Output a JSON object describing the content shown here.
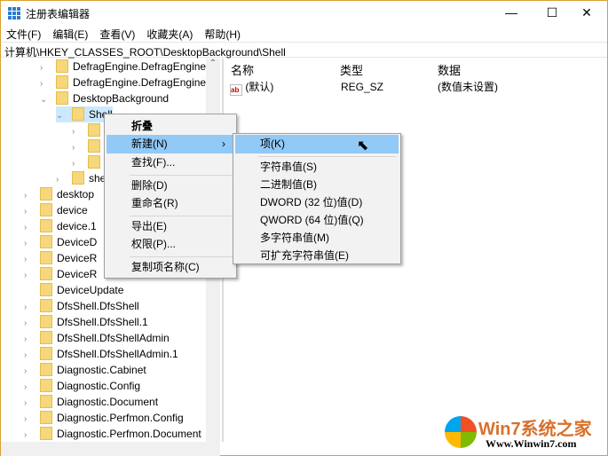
{
  "window": {
    "title": "注册表编辑器",
    "minimize": "—",
    "maximize": "☐",
    "close": "✕"
  },
  "menubar": [
    "文件(F)",
    "编辑(E)",
    "查看(V)",
    "收藏夹(A)",
    "帮助(H)"
  ],
  "address": "计算机\\HKEY_CLASSES_ROOT\\DesktopBackground\\Shell",
  "tree": [
    {
      "label": "DefragEngine.DefragEngine",
      "chev": ">"
    },
    {
      "label": "DefragEngine.DefragEngine.1",
      "chev": ">"
    },
    {
      "label": "DesktopBackground",
      "chev": "v"
    },
    {
      "label": "Shell",
      "chev": "v"
    },
    {
      "label": "",
      "chev": ">"
    },
    {
      "label": "",
      "chev": ">"
    },
    {
      "label": "",
      "chev": ">"
    },
    {
      "label": "shel",
      "chev": ">"
    },
    {
      "label": "desktop",
      "chev": ">"
    },
    {
      "label": "device",
      "chev": ">"
    },
    {
      "label": "device.1",
      "chev": ">"
    },
    {
      "label": "DeviceD",
      "chev": ">"
    },
    {
      "label": "DeviceR",
      "chev": ">"
    },
    {
      "label": "DeviceR",
      "chev": ">"
    },
    {
      "label": "DeviceUpdate",
      "chev": ""
    },
    {
      "label": "DfsShell.DfsShell",
      "chev": ">"
    },
    {
      "label": "DfsShell.DfsShell.1",
      "chev": ">"
    },
    {
      "label": "DfsShell.DfsShellAdmin",
      "chev": ">"
    },
    {
      "label": "DfsShell.DfsShellAdmin.1",
      "chev": ">"
    },
    {
      "label": "Diagnostic.Cabinet",
      "chev": ">"
    },
    {
      "label": "Diagnostic.Config",
      "chev": ">"
    },
    {
      "label": "Diagnostic.Document",
      "chev": ">"
    },
    {
      "label": "Diagnostic.Perfmon.Config",
      "chev": ">"
    },
    {
      "label": "Diagnostic.Perfmon.Document",
      "chev": ">"
    }
  ],
  "columns": {
    "name": "名称",
    "type": "类型",
    "data": "数据"
  },
  "values": [
    {
      "name": "(默认)",
      "type": "REG_SZ",
      "data": "(数值未设置)",
      "icon": "ab"
    }
  ],
  "context_menu": [
    "折叠",
    "新建(N)",
    "查找(F)...",
    "删除(D)",
    "重命名(R)",
    "导出(E)",
    "权限(P)...",
    "复制项名称(C)"
  ],
  "submenu": [
    "项(K)",
    "字符串值(S)",
    "二进制值(B)",
    "DWORD (32 位)值(D)",
    "QWORD (64 位)值(Q)",
    "多字符串值(M)",
    "可扩充字符串值(E)"
  ],
  "watermark": {
    "brand": "Win7系统之家",
    "url": "Www.Winwin7.com"
  }
}
